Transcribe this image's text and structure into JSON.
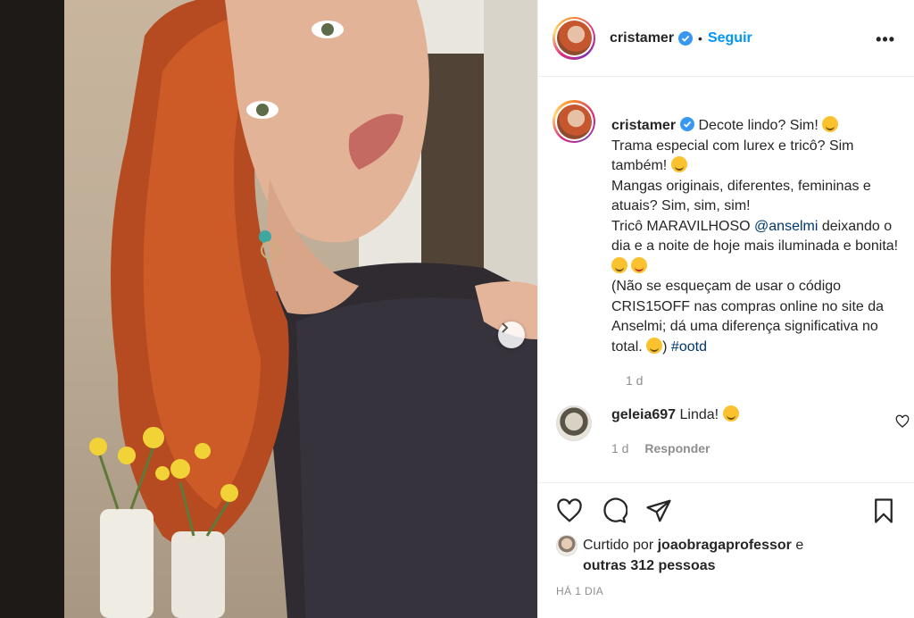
{
  "post": {
    "username": "cristamer",
    "follow_label": "Seguir",
    "dot": "•",
    "more": "•••"
  },
  "caption": {
    "username": "cristamer",
    "line1": "Decote lindo? Sim!",
    "line2": "Trama especial com lurex e tricô? Sim também!",
    "line3": "Mangas originais, diferentes, femininas e atuais? Sim, sim, sim!",
    "line4a": "Tricô MARAVILHOSO",
    "mention": "@anselmi",
    "line4b": "deixando o dia e a noite de hoje mais iluminada e bonita!",
    "line5": "(Não se esqueçam de usar o código CRIS15OFF nas compras online no site da Anselmi; dá uma diferença significativa no total.",
    "line5_end": ")",
    "hashtag": "#ootd",
    "time": "1 d"
  },
  "comment": {
    "username": "geleia697",
    "text": "Linda!",
    "time": "1 d",
    "reply_label": "Responder"
  },
  "likes": {
    "prefix": "Curtido por",
    "user": "joaobragaprofessor",
    "and": "e",
    "others": "outras 312 pessoas"
  },
  "post_time": "HÁ 1 DIA",
  "colors": {
    "accent": "#0095f6",
    "link": "#00376b",
    "muted": "#8e8e8e",
    "text": "#262626"
  }
}
